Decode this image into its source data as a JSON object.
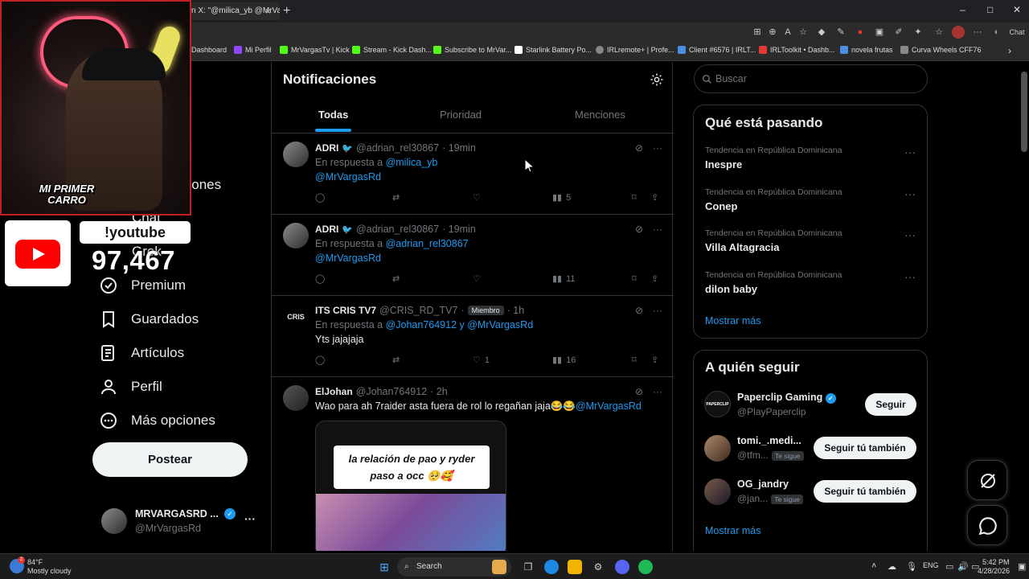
{
  "browser": {
    "tab_title": "n X: \"@milica_yb @MrVa",
    "tab_close": "×",
    "new_tab": "+",
    "profile_label": "Chat",
    "window_buttons": [
      "–",
      "□",
      "✕"
    ]
  },
  "bookmarks": [
    {
      "label": "Dashboard",
      "color": "#9146ff"
    },
    {
      "label": "Mi Perfil",
      "color": "#9146ff"
    },
    {
      "label": "MrVargasTv | Kick",
      "color": "#53fc18"
    },
    {
      "label": "Stream - Kick Dash...",
      "color": "#53fc18"
    },
    {
      "label": "Subscribe to MrVar...",
      "color": "#53fc18"
    },
    {
      "label": "Starlink Battery Po...",
      "color": "#ffffff"
    },
    {
      "label": "IRLremote+ | Profe...",
      "color": "#888888"
    },
    {
      "label": "Client #6576 | IRLT...",
      "color": "#4a90e2"
    },
    {
      "label": "IRLToolkit • Dashb...",
      "color": "#e53935"
    },
    {
      "label": "novela frutas",
      "color": "#4a90e2"
    },
    {
      "label": "Curva Wheels CFF76",
      "color": "#888888"
    }
  ],
  "overlay": {
    "car_text_1": "MI PRIMER",
    "car_text_2": "CARRO",
    "yt_command": "!youtube",
    "yt_count": "97,467"
  },
  "nav": {
    "partial_1": "ciones",
    "partial_2": "Chat",
    "partial_3": "Grok",
    "items": [
      {
        "label": "Premium"
      },
      {
        "label": "Guardados"
      },
      {
        "label": "Artículos"
      },
      {
        "label": "Perfil"
      },
      {
        "label": "Más opciones"
      }
    ],
    "post_button": "Postear",
    "account_name": "MRVARGASRD ...",
    "account_handle": "@MrVargasRd",
    "account_more": "···"
  },
  "notifications": {
    "title": "Notificaciones",
    "tabs": [
      "Todas",
      "Prioridad",
      "Menciones"
    ],
    "tweets": [
      {
        "name": "ADRI",
        "handle": "@adrian_rel30867",
        "time": "· 19min",
        "reply_prefix": "En respuesta a",
        "reply_to": "@milica_yb",
        "mention": "@MrVargasRd",
        "views": "5"
      },
      {
        "name": "ADRI",
        "handle": "@adrian_rel30867",
        "time": "· 19min",
        "reply_prefix": "En respuesta a",
        "reply_to": "@adrian_rel30867",
        "mention": "@MrVargasRd",
        "views": "11"
      },
      {
        "name": "ITS CRIS TV7",
        "handle": "@CRIS_RD_TV7",
        "badge": "Miembro",
        "time": "· 1h",
        "reply_prefix": "En respuesta a",
        "reply_to": "@Johan764912 y @MrVargasRd",
        "text": "Yts jajajaja",
        "likes": "1",
        "views": "16",
        "avatar_text": "CRIS"
      },
      {
        "name": "ElJohan",
        "handle": "@Johan764912",
        "time": "· 2h",
        "text": "Wao para ah 7raider asta fuera de rol lo regañan jaja😂😂",
        "mention": "@MrVargasRd",
        "media_caption_1": "la relación de pao y ryder",
        "media_caption_2": "paso a occ 🥺🥰"
      }
    ]
  },
  "search": {
    "placeholder": "Buscar"
  },
  "trends": {
    "title": "Qué está pasando",
    "items": [
      {
        "context": "Tendencia en República Dominicana",
        "name": "Inespre"
      },
      {
        "context": "Tendencia en República Dominicana",
        "name": "Conep"
      },
      {
        "context": "Tendencia en República Dominicana",
        "name": "Villa Altagracia"
      },
      {
        "context": "Tendencia en República Dominicana",
        "name": "dilon baby"
      }
    ],
    "more": "Mostrar más"
  },
  "who_to_follow": {
    "title": "A quién seguir",
    "items": [
      {
        "name": "Paperclip Gaming",
        "handle": "@PlayPaperclip",
        "button": "Seguir",
        "avatar_text": "PAPERCLIP"
      },
      {
        "name": "tomi._.medi...",
        "handle": "@tfm...",
        "follows_you": "Te sigue",
        "button": "Seguir tú también"
      },
      {
        "name": "OG_jandry",
        "handle": "@jan...",
        "follows_you": "Te sigue",
        "button": "Seguir tú también"
      }
    ],
    "more": "Mostrar más"
  },
  "taskbar": {
    "weather_temp": "84°F",
    "weather_desc": "Mostly cloudy",
    "weather_badge": "2",
    "search": "Search",
    "lang": "ENG",
    "time": "5:42 PM",
    "date": "4/28/2026"
  },
  "colors": {
    "accent": "#1d9bf0",
    "border": "#2f3336",
    "muted": "#71767b"
  }
}
